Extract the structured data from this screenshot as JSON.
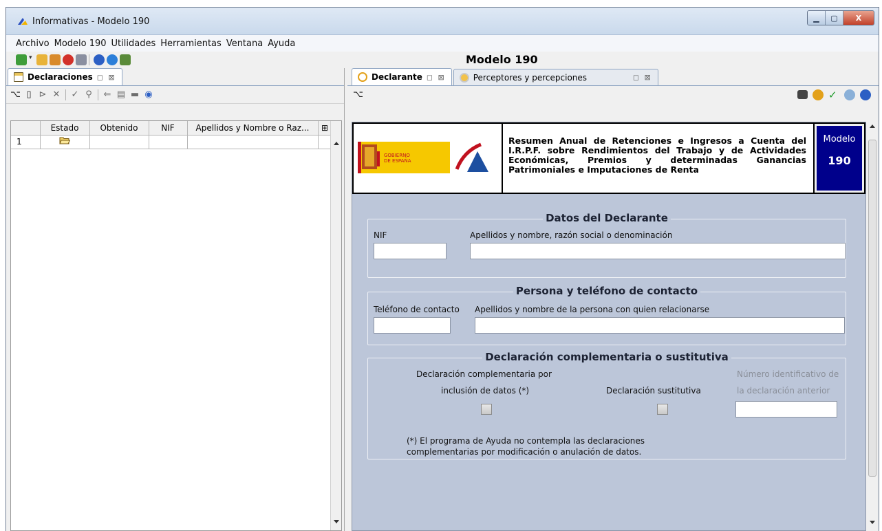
{
  "window": {
    "title": "Informativas - Modelo 190",
    "minimize_label": "▁",
    "maximize_label": "▢",
    "close_label": "X"
  },
  "menu": [
    "Archivo",
    "Modelo 190",
    "Utilidades",
    "Herramientas",
    "Ventana",
    "Ayuda"
  ],
  "app_heading": "Modelo 190",
  "left_pane": {
    "tab_label": "Declaraciones",
    "tab_controls": "◻ ⊠",
    "table": {
      "headers": [
        "",
        "Estado",
        "Obtenido",
        "NIF",
        "Apellidos y Nombre o Raz..."
      ],
      "rows": [
        {
          "num": "1",
          "estado_icon": "open-folder-icon"
        }
      ]
    }
  },
  "right_pane": {
    "tabs": [
      {
        "label": "Declarante",
        "controls": "◻ ⊠"
      },
      {
        "label": "Perceptores y percepciones",
        "controls": "◻ ⊠"
      }
    ],
    "banner": {
      "gobierno_line1": "GOBIERNO",
      "gobierno_line2": "DE ESPAÑA",
      "description": "Resumen Anual de Retenciones e Ingresos a Cuenta del I.R.P.F. sobre Rendimientos del Trabajo y de Actividades Económicas, Premios y determinadas Ganancias Patrimoniales e Imputaciones de Renta",
      "modelo_label": "Modelo",
      "modelo_number": "190"
    },
    "datos_declarante": {
      "legend": "Datos del Declarante",
      "nif_label": "NIF",
      "nif_value": "",
      "nombre_label": "Apellidos y nombre, razón social o denominación",
      "nombre_value": ""
    },
    "contacto": {
      "legend": "Persona y teléfono de contacto",
      "telefono_label": "Teléfono de contacto",
      "telefono_value": "",
      "persona_label": "Apellidos y nombre de la persona con quien relacionarse",
      "persona_value": ""
    },
    "complementaria": {
      "legend": "Declaración complementaria o sustitutiva",
      "compl_label_1": "Declaración complementaria por",
      "compl_label_2": "inclusión de datos (*)",
      "sustitutiva_label": "Declaración sustitutiva",
      "numero_label_1": "Número identificativo de",
      "numero_label_2": "la declaración anterior",
      "numero_value": "",
      "complementaria_checked": false,
      "sustitutiva_checked": false,
      "note_line1": "(*) El programa de Ayuda no contempla las declaraciones",
      "note_line2": "complementarias por modificación o anulación de datos."
    }
  },
  "colors": {
    "form_background": "#bcc6d9",
    "modelo_box": "#00008b"
  }
}
